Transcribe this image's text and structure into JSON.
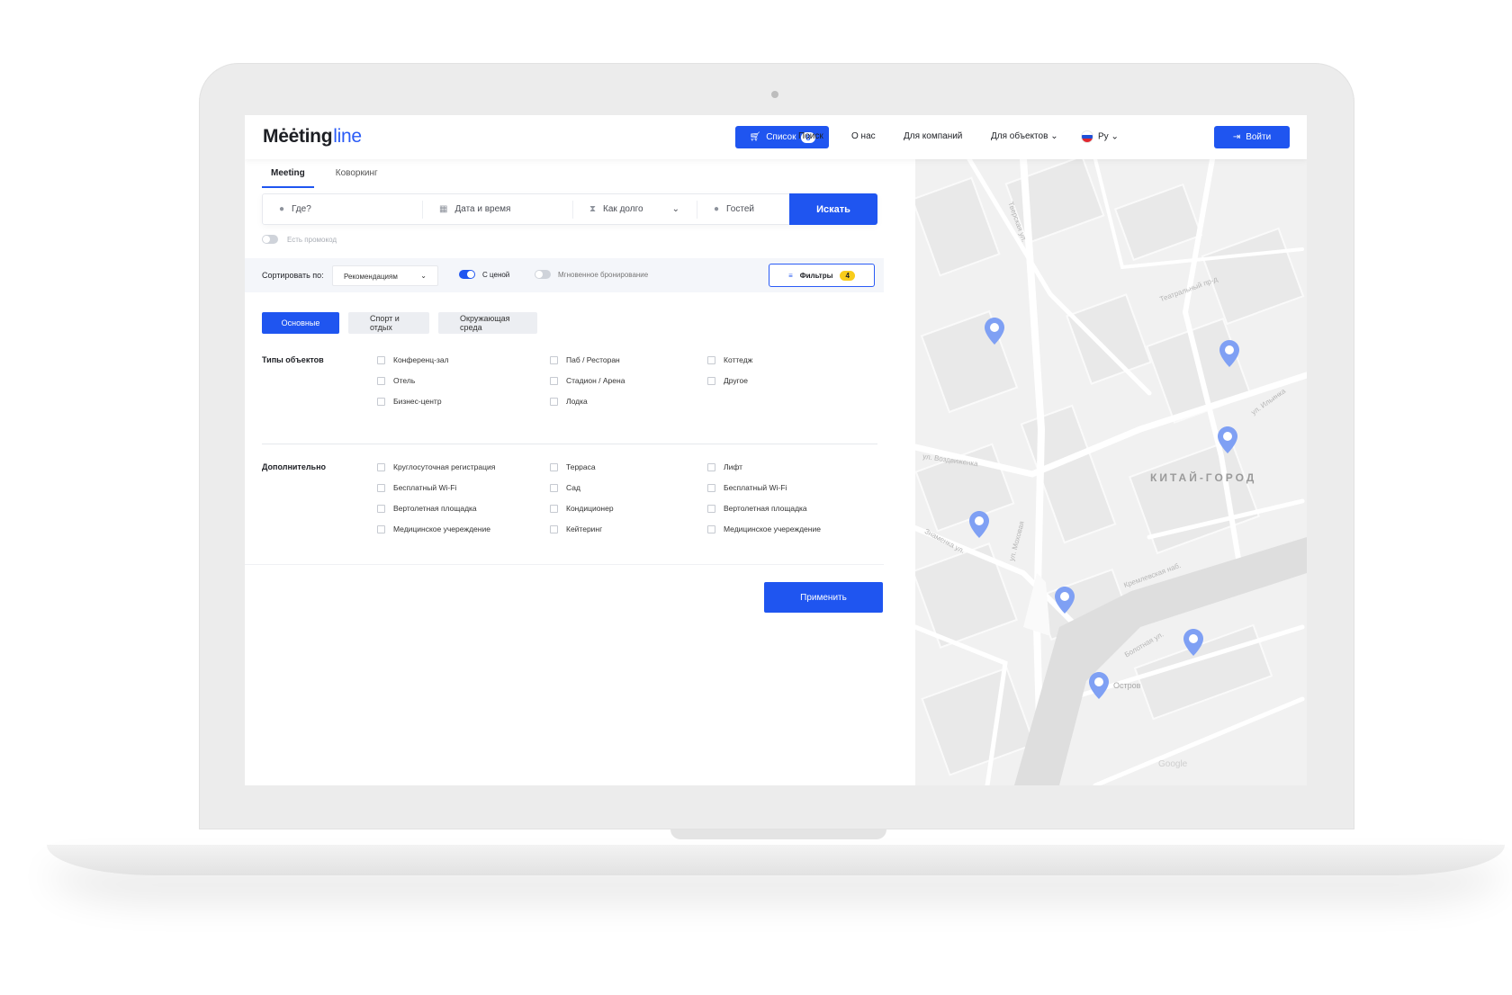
{
  "header": {
    "logo_main": "Mėėting",
    "logo_sub": "line",
    "list_label": "Список",
    "list_count": "8",
    "nav": [
      "Поиск",
      "О нас",
      "Для компаний",
      "Для объектов"
    ],
    "lang": "Ру",
    "login_label": "Войти"
  },
  "tabs": [
    "Meeting",
    "Коворкинг"
  ],
  "search": {
    "where": "Где?",
    "datetime": "Дата и время",
    "duration": "Как долго",
    "guests": "Гостей",
    "submit": "Искать"
  },
  "promo": "Есть промокод",
  "sort": {
    "label": "Сортировать по:",
    "value": "Рекомендациям",
    "with_price": "С ценой",
    "instant": "Мгновенное бронирование",
    "filters_label": "Фильтры",
    "filters_count": "4"
  },
  "filter_tabs": [
    "Основные",
    "Спорт и отдых",
    "Окружающая среда"
  ],
  "types": {
    "title": "Типы объектов",
    "items": [
      "Конференц-зал",
      "Отель",
      "Бизнес-центр",
      "Паб / Ресторан",
      "Стадион / Арена",
      "Лодка",
      "Коттедж",
      "Другое"
    ]
  },
  "extra": {
    "title": "Дополнительно",
    "items": [
      "Круглосуточная регистрация",
      "Бесплатный Wi-Fi",
      "Вертолетная площадка",
      "Медицинское учереждение",
      "Терраса",
      "Сад",
      "Кондиционер",
      "Кейтеринг",
      "Лифт",
      "Бесплатный Wi-Fi",
      "Вертолетная площадка",
      "Медицинское учереждение"
    ]
  },
  "apply_label": "Применить",
  "map": {
    "district": "КИТАЙ-ГОРОД",
    "streets": [
      "Тверская ул.",
      "Театральный пр-д",
      "ул. Воздвиженка",
      "ул. Моховая",
      "Знаменка ул.",
      "Кремлевская наб.",
      "Болотная ул.",
      "Остров",
      "ул. Ильинка"
    ],
    "google": "Google",
    "pin_color": "#7fa0f4"
  },
  "colors": {
    "accent": "#1f55f0",
    "badge": "#f8cc1b"
  }
}
